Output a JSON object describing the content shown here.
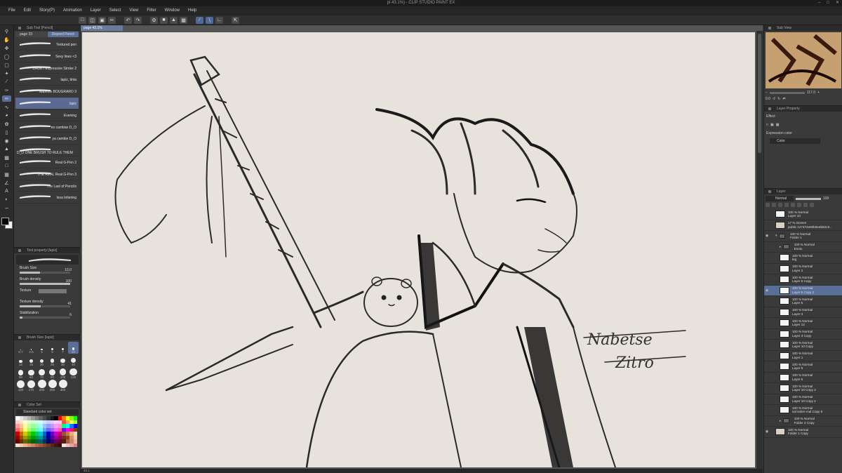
{
  "app_title": "pi 43.1%) - CLIP STUDIO PAINT EX",
  "menu": [
    "File",
    "Edit",
    "Story(P)",
    "Animation",
    "Layer",
    "Select",
    "View",
    "Filter",
    "Window",
    "Help"
  ],
  "left": {
    "subtool_header": "Sub Tool [Pencil]",
    "tabs": [
      "page 33",
      "Dispred Pencil"
    ],
    "brushes": [
      {
        "name": "Textured pen"
      },
      {
        "name": "Sexy lines <3"
      },
      {
        "name": "DAUB / Expressive Stroke 2"
      },
      {
        "name": "lapiz, tinta"
      },
      {
        "name": "Nabetse BOUGRARO 3"
      },
      {
        "name": "lapiz",
        "selected": true
      },
      {
        "name": "Evening"
      },
      {
        "name": "no cambiar D_O"
      },
      {
        "name": "ya cambie D_O"
      },
      {
        "name": "D_O ONE BRUSH TO RULE THEM"
      },
      {
        "name": "Real G-Pen 2"
      },
      {
        "name": "THE REAL Real G-Pen 3"
      },
      {
        "name": "The Last of Pencils"
      },
      {
        "name": "lexa lettering"
      }
    ],
    "toolprop_header": "Tool property [lapiz]",
    "props": {
      "brush_size_label": "Brush Size",
      "brush_size_value": "10.0",
      "brush_density_label": "Brush density",
      "brush_density_value": "100",
      "texture_label": "Texture",
      "texture_density_label": "Texture density",
      "texture_density_value": "41",
      "stabilization_label": "Stabilization",
      "stabilization_value": "6"
    },
    "brushsize_header": "Brush Size [lapiz]",
    "sizes": [
      "0.7",
      "2.5",
      "4",
      "5",
      "7",
      "10",
      "12",
      "15",
      "20",
      "25",
      "30",
      "40",
      "50",
      "60",
      "70",
      "80",
      "100",
      "120",
      "150",
      "170",
      "200",
      "250",
      "300"
    ],
    "selected_size": "10",
    "colorset_header": "Color Set",
    "colorset_name": "Standard color set",
    "swatch_colors": [
      "#ffffff",
      "#e6e6e6",
      "#cccccc",
      "#b3b3b3",
      "#999999",
      "#808080",
      "#666666",
      "#4d4d4d",
      "#333333",
      "#1a1a1a",
      "#000000",
      "#ff0000",
      "#ff8000",
      "#ffff00",
      "#80ff00",
      "#00ff00",
      "#ffcccc",
      "#ffe0cc",
      "#ffffcc",
      "#e0ffcc",
      "#ccffcc",
      "#ccffe0",
      "#ccffff",
      "#cce0ff",
      "#ccccff",
      "#e0ccff",
      "#ffccff",
      "#ffcce0",
      "#ff4d4d",
      "#ffa64d",
      "#ffff4d",
      "#a6ff4d",
      "#ff9999",
      "#ffc299",
      "#ffff99",
      "#c2ff99",
      "#99ff99",
      "#99ffc2",
      "#99ffff",
      "#99c2ff",
      "#9999ff",
      "#c299ff",
      "#ff99ff",
      "#ff99c2",
      "#00ff80",
      "#00ffff",
      "#0080ff",
      "#0000ff",
      "#ff6666",
      "#ffa366",
      "#ffff66",
      "#a3ff66",
      "#66ff66",
      "#66ffa3",
      "#66ffff",
      "#66a3ff",
      "#6666ff",
      "#a366ff",
      "#ff66ff",
      "#ff66a3",
      "#8000ff",
      "#ff00ff",
      "#ff0080",
      "#804000",
      "#cc0000",
      "#cc6600",
      "#cccc00",
      "#66cc00",
      "#00cc00",
      "#00cc66",
      "#00cccc",
      "#0066cc",
      "#0000cc",
      "#6600cc",
      "#cc00cc",
      "#cc0066",
      "#a05030",
      "#c08040",
      "#e0b080",
      "#f0d8b0",
      "#990000",
      "#994d00",
      "#999900",
      "#4d9900",
      "#009900",
      "#00994d",
      "#009999",
      "#004d99",
      "#000099",
      "#4d0099",
      "#990099",
      "#99004d",
      "#703020",
      "#904020",
      "#d09070",
      "#f0c8a8",
      "#660000",
      "#663300",
      "#666600",
      "#336600",
      "#006600",
      "#006633",
      "#006666",
      "#003366",
      "#000066",
      "#330066",
      "#660066",
      "#660033",
      "#502010",
      "#a06040",
      "#c88868",
      "#e8b898",
      "#ffe0d0",
      "#f8c8b0",
      "#f0b090",
      "#e09870",
      "#d08060",
      "#b86848",
      "#a05838",
      "#884828",
      "#703818",
      "#582810",
      "#401808",
      "#301000",
      "#f8e0e0",
      "#f0c0c0",
      "#e8a0a0",
      "#d88080"
    ]
  },
  "canvas": {
    "doc_tab": "page 43.1%",
    "signature_line1": "Nabetse",
    "signature_line2": "Zitro",
    "status": "43.1"
  },
  "right": {
    "navigator_header": "Sub View",
    "zoom": "117.0",
    "angle": "0.0",
    "layerprop_header": "Layer Property",
    "effect_label": "Effect",
    "expression_label": "Expression color",
    "expression_value": "Color",
    "layer_header": "Layer",
    "blend_mode": "Normal",
    "opacity": "100",
    "layers": [
      {
        "line1": "100 % Normal",
        "line2": "Layer 10",
        "indent": 0,
        "thumb": "white"
      },
      {
        "line1": "17 % Screen",
        "line2": "public 127474e80b6e4b62c8...",
        "indent": 0,
        "thumb": "beige"
      },
      {
        "line1": "100 % Normal",
        "line2": "Folder 1",
        "indent": 0,
        "folder": true,
        "open": true
      },
      {
        "line1": "100 % Normal",
        "line2": "Ennio",
        "indent": 6,
        "folder": true
      },
      {
        "line1": "100 % Normal",
        "line2": "leg",
        "indent": 6,
        "thumb": "white"
      },
      {
        "line1": "100 % Normal",
        "line2": "Layer 2",
        "indent": 6,
        "thumb": "white"
      },
      {
        "line1": "100 % Normal",
        "line2": "Layer 5 Copy",
        "indent": 6,
        "thumb": "white"
      },
      {
        "line1": "100 % Normal",
        "line2": "Layer 5 Copy 2",
        "indent": 6,
        "thumb": "white",
        "selected": true
      },
      {
        "line1": "100 % Normal",
        "line2": "Layer 5",
        "indent": 6,
        "thumb": "white"
      },
      {
        "line1": "100 % Normal",
        "line2": "Layer 3",
        "indent": 6,
        "thumb": "white"
      },
      {
        "line1": "100 % Normal",
        "line2": "Layer 12",
        "indent": 6,
        "thumb": "white"
      },
      {
        "line1": "100 % Normal",
        "line2": "Layer 3 Copy",
        "indent": 6,
        "thumb": "white"
      },
      {
        "line1": "100 % Normal",
        "line2": "Layer 10 Copy",
        "indent": 6,
        "thumb": "white"
      },
      {
        "line1": "100 % Normal",
        "line2": "Layer 1",
        "indent": 6,
        "thumb": "white"
      },
      {
        "line1": "100 % Normal",
        "line2": "Layer 9",
        "indent": 6,
        "thumb": "white"
      },
      {
        "line1": "100 % Normal",
        "line2": "Layer 6",
        "indent": 6,
        "thumb": "white"
      },
      {
        "line1": "100 % Normal",
        "line2": "Layer 10 Copy 3",
        "indent": 6,
        "thumb": "white"
      },
      {
        "line1": "100 % Normal",
        "line2": "Layer 10 Copy 2",
        "indent": 6,
        "thumb": "white"
      },
      {
        "line1": "100 % Normal",
        "line2": "val sobre mal Copy 5",
        "indent": 6,
        "thumb": "white"
      },
      {
        "line1": "100 % Normal",
        "line2": "Folder 2 Copy",
        "indent": 6,
        "folder": true
      },
      {
        "line1": "100 % Normal",
        "line2": "Folder 1 Copy",
        "indent": 0,
        "thumb": "beige"
      }
    ]
  }
}
